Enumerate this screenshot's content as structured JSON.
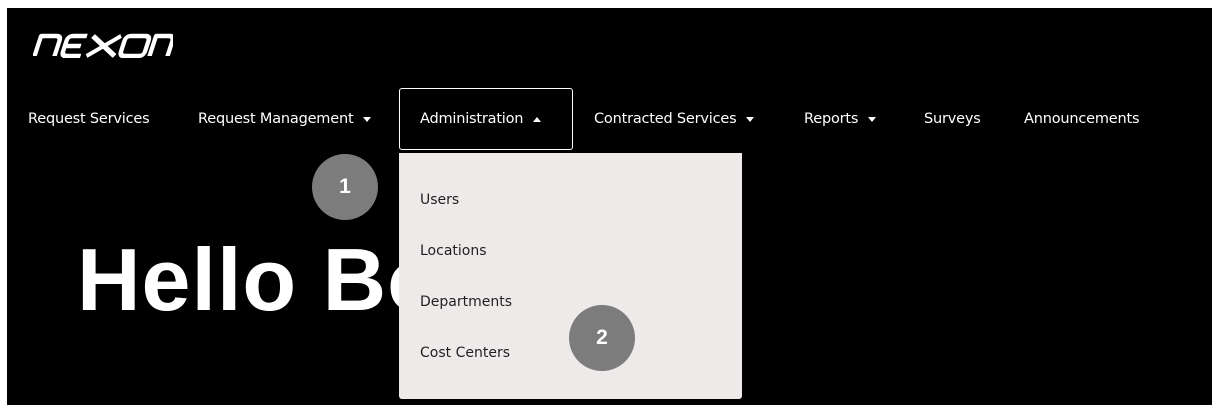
{
  "header": {
    "logo_icon": "nexon-logo-icon"
  },
  "nav": {
    "items": [
      {
        "label": "Request Services",
        "caret": "none"
      },
      {
        "label": "Request Management",
        "caret": "down"
      },
      {
        "label": "Administration",
        "caret": "up",
        "active": true
      },
      {
        "label": "Contracted Services",
        "caret": "down"
      },
      {
        "label": "Reports",
        "caret": "down"
      },
      {
        "label": "Surveys",
        "caret": "none"
      },
      {
        "label": "Announcements",
        "caret": "none"
      }
    ]
  },
  "hero": {
    "greeting": "Hello Bob!"
  },
  "dropdown": {
    "items": [
      "Users",
      "Locations",
      "Departments",
      "Cost Centers"
    ]
  },
  "callouts": {
    "first": "1",
    "second": "2"
  },
  "colors": {
    "background": "#000000",
    "dropdown_bg": "#efeaea",
    "badge": "#7c7c7c",
    "text": "#ffffff"
  }
}
